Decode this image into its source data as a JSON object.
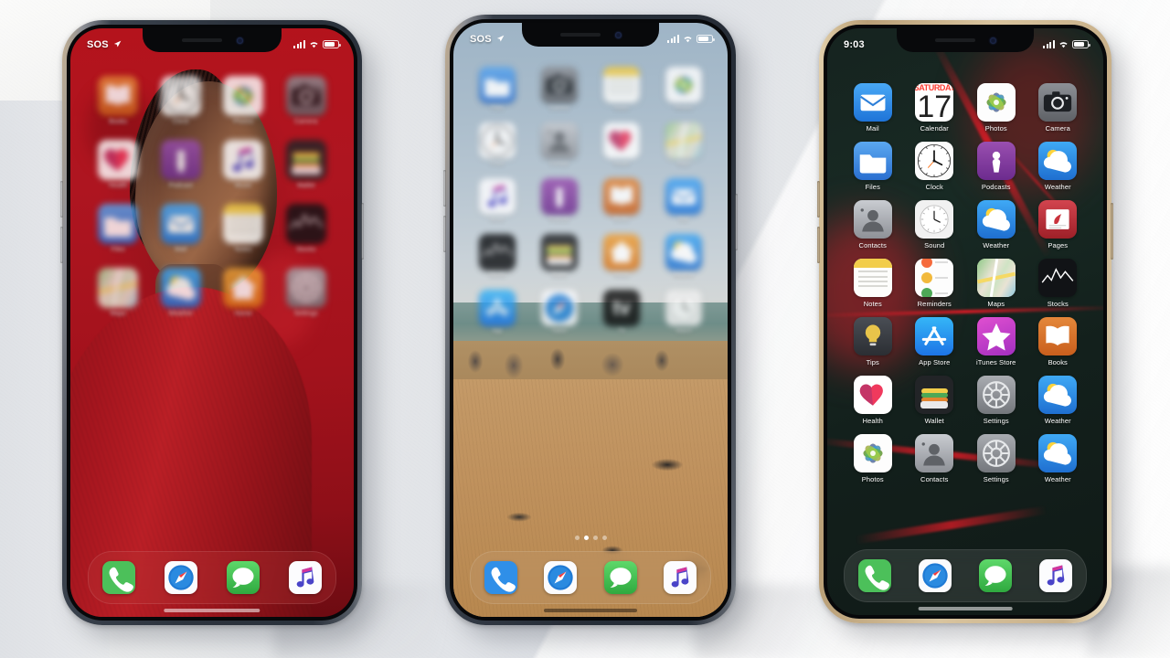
{
  "scene": {
    "title": "Three iPhones on a wall showing home screens",
    "background_color": "#e6e8ea",
    "phone_count": 3
  },
  "phones": [
    {
      "id": "phone-left",
      "frame_color": "#2f3742",
      "frame_name": "graphite",
      "wallpaper": "red portrait photo",
      "wallpaper_color": "#a3121c",
      "focus": "blurred",
      "status": {
        "carrier": "SOS",
        "location_icon": "location-arrow-icon",
        "signal_icon": "cellular-bars-icon",
        "wifi_icon": "wifi-icon",
        "battery_icon": "battery-icon"
      },
      "apps": [
        {
          "label": "Books",
          "icon": "books-icon",
          "color": "#c8622a"
        },
        {
          "label": "Clock",
          "icon": "clock-icon",
          "color": "#0d0d0f"
        },
        {
          "label": "Photos",
          "icon": "photos-icon",
          "color": "#f3f3f3"
        },
        {
          "label": "Camera",
          "icon": "camera-icon",
          "color": "#6f7175"
        },
        {
          "label": "Health",
          "icon": "health-icon",
          "color": "#12121a"
        },
        {
          "label": "Podcast",
          "icon": "podcasts-icon",
          "color": "#8a3b8f"
        },
        {
          "label": "Music",
          "icon": "music-icon",
          "color": "#b6242c"
        },
        {
          "label": "Wallet",
          "icon": "wallet-icon",
          "color": "#24262b"
        },
        {
          "label": "Files",
          "icon": "files-icon",
          "color": "#2e6fd4"
        },
        {
          "label": "Mail",
          "icon": "mail-icon",
          "color": "#2b7de0"
        },
        {
          "label": "Notes",
          "icon": "notes-icon",
          "color": "#e8d46a"
        },
        {
          "label": "Stocks",
          "icon": "stocks-icon",
          "color": "#16161a"
        },
        {
          "label": "Maps",
          "icon": "maps-icon",
          "color": "#6fae6a"
        },
        {
          "label": "Weather",
          "icon": "weather-icon",
          "color": "#2f8fe0"
        },
        {
          "label": "Home",
          "icon": "home-icon",
          "color": "#e0861f"
        },
        {
          "label": "Settings",
          "icon": "settings-icon",
          "color": "#7a7d82"
        }
      ],
      "dock": [
        {
          "label": "Phone",
          "icon": "phone-icon",
          "color": "#4cc05a"
        },
        {
          "label": "Safari",
          "icon": "safari-icon",
          "color": "#f4f4f6"
        },
        {
          "label": "Messages",
          "icon": "messages-icon",
          "color": "#4cc05a"
        },
        {
          "label": "Music",
          "icon": "music-icon",
          "color": "#f7f7f9"
        }
      ]
    },
    {
      "id": "phone-center",
      "frame_color": "#2b323c",
      "frame_name": "graphite",
      "wallpaper": "rocky shore and sand beach photo",
      "wallpaper_color": "#c0925e",
      "focus": "blurred",
      "status": {
        "carrier": "SOS",
        "location_icon": "location-arrow-icon",
        "signal_icon": "cellular-bars-icon",
        "wifi_icon": "wifi-icon",
        "battery_icon": "battery-icon"
      },
      "page_dots": {
        "count": 4,
        "active_index": 1
      },
      "apps": [
        {
          "label": "Files",
          "icon": "files-icon",
          "color": "#3b4148"
        },
        {
          "label": "Camera",
          "icon": "camera-icon",
          "color": "#cfd6dc"
        },
        {
          "label": "Notes",
          "icon": "notes-icon",
          "color": "#33402f"
        },
        {
          "label": "Photos",
          "icon": "photos-icon",
          "color": "#d7c3b3"
        },
        {
          "label": "Clock",
          "icon": "clock-icon",
          "color": "#5a646e"
        },
        {
          "label": "Contact",
          "icon": "contacts-icon",
          "color": "#8a7a70"
        },
        {
          "label": "Health",
          "icon": "health-icon",
          "color": "#b8c4cc"
        },
        {
          "label": "Maps",
          "icon": "maps-icon",
          "color": "#9aa6ae"
        },
        {
          "label": "Music",
          "icon": "music-icon",
          "color": "#b7c0c6"
        },
        {
          "label": "Podcast",
          "icon": "podcasts-icon",
          "color": "#4a4540"
        },
        {
          "label": "Books",
          "icon": "books-icon",
          "color": "#8a8077"
        },
        {
          "label": "Mail",
          "icon": "mail-icon",
          "color": "#a9bfae"
        },
        {
          "label": "Stocks",
          "icon": "stocks-icon",
          "color": "#59636b"
        },
        {
          "label": "Wallet",
          "icon": "wallet-icon",
          "color": "#6c6159"
        },
        {
          "label": "Home",
          "icon": "home-icon",
          "color": "#7e8c92"
        },
        {
          "label": "Weather",
          "icon": "weather-icon",
          "color": "#a3968a"
        },
        {
          "label": "App",
          "icon": "appstore-icon",
          "color": "#d8d8d8"
        },
        {
          "label": "Safari",
          "icon": "safari-icon",
          "color": "#8e3b34"
        },
        {
          "label": "TV",
          "icon": "tv-icon",
          "color": "#c6b39a"
        },
        {
          "label": "Watch",
          "icon": "watch-icon",
          "color": "#8f7f72"
        }
      ],
      "dock": [
        {
          "label": "Phone",
          "icon": "phone-icon",
          "color": "#2f8fe8"
        },
        {
          "label": "Safari",
          "icon": "safari-icon",
          "color": "#f4f4f6"
        },
        {
          "label": "Messages",
          "icon": "messages-icon",
          "color": "#4cc05a"
        },
        {
          "label": "Music",
          "icon": "music-icon",
          "color": "#f7f7f9"
        }
      ]
    },
    {
      "id": "phone-right",
      "frame_color": "#d8c09a",
      "frame_name": "gold",
      "wallpaper": "dark green abstract with red light streaks",
      "wallpaper_color": "#16231f",
      "focus": "sharp",
      "status": {
        "time": "9:03",
        "signal_icon": "cellular-bars-icon",
        "wifi_icon": "wifi-icon",
        "battery_icon": "battery-icon"
      },
      "calendar_day": "17",
      "apps": [
        {
          "label": "Mail",
          "icon": "mail-icon",
          "color": "#2b7de0"
        },
        {
          "label": "Calendar",
          "icon": "calendar-icon",
          "color": "#ffffff"
        },
        {
          "label": "Photos",
          "icon": "photos-icon",
          "color": "#fbfbfb"
        },
        {
          "label": "Camera",
          "icon": "camera-icon",
          "color": "#6f7175"
        },
        {
          "label": "Files",
          "icon": "files-icon",
          "color": "#6c2f33"
        },
        {
          "label": "Clock",
          "icon": "clock-icon",
          "color": "#f2f2f2"
        },
        {
          "label": "Podcasts",
          "icon": "podcasts-icon",
          "color": "#4a4d52"
        },
        {
          "label": "Weather",
          "icon": "weather-icon",
          "color": "#2f8fe0"
        },
        {
          "label": "Contacts",
          "icon": "contacts-icon",
          "color": "#b9bcc1"
        },
        {
          "label": "Sound",
          "icon": "watch-icon",
          "color": "#f0f0f0"
        },
        {
          "label": "Weather",
          "icon": "weather-icon",
          "color": "#2f8fe0"
        },
        {
          "label": "Pages",
          "icon": "pages-icon",
          "color": "#c0323c"
        },
        {
          "label": "Notes",
          "icon": "notes-icon",
          "color": "#f2e8c8"
        },
        {
          "label": "Reminders",
          "icon": "reminders-icon",
          "color": "#fbfbfb"
        },
        {
          "label": "Maps",
          "icon": "maps-icon",
          "color": "#7fc27a"
        },
        {
          "label": "Stocks",
          "icon": "stocks-icon",
          "color": "#131317"
        },
        {
          "label": "Tips",
          "icon": "tips-icon",
          "color": "#33373c"
        },
        {
          "label": "App Store",
          "icon": "appstore-icon",
          "color": "#2b8ae6"
        },
        {
          "label": "iTunes Store",
          "icon": "itunes-icon",
          "color": "#cd3ac4"
        },
        {
          "label": "Books",
          "icon": "books-icon",
          "color": "#d2701f"
        },
        {
          "label": "Health",
          "icon": "health-icon",
          "color": "#fbfbfb"
        },
        {
          "label": "Wallet",
          "icon": "wallet-icon",
          "color": "#2b2b30"
        },
        {
          "label": "Settings",
          "icon": "settings-icon",
          "color": "#8b8e93"
        },
        {
          "label": "Weather",
          "icon": "weather-icon",
          "color": "#2f8fe0"
        },
        {
          "label": "Photos",
          "icon": "photos-icon",
          "color": "#fbfbfb"
        },
        {
          "label": "Contacts",
          "icon": "contacts-icon",
          "color": "#b9bcc1"
        },
        {
          "label": "Settings",
          "icon": "settings-icon",
          "color": "#8b8e93"
        },
        {
          "label": "Weather",
          "icon": "weather-icon",
          "color": "#2f8fe0"
        }
      ],
      "dock": [
        {
          "label": "Phone",
          "icon": "phone-icon",
          "color": "#4cc05a"
        },
        {
          "label": "Safari",
          "icon": "safari-icon",
          "color": "#f4f4f6"
        },
        {
          "label": "Messages",
          "icon": "messages-icon",
          "color": "#4cc05a"
        },
        {
          "label": "Music",
          "icon": "music-icon",
          "color": "#f7f7f9"
        }
      ]
    }
  ]
}
